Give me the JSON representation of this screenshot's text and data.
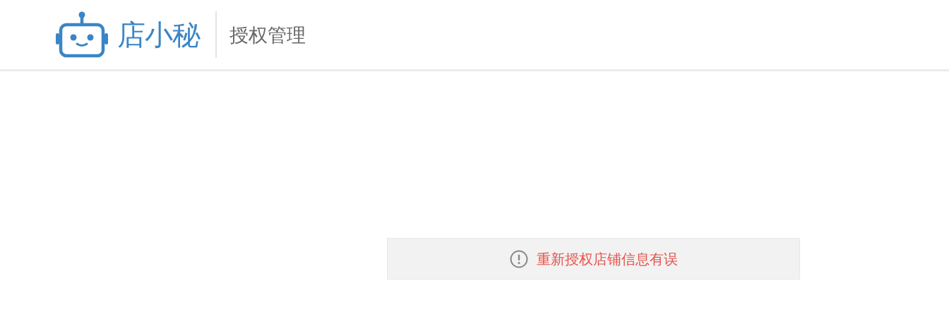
{
  "header": {
    "brand": "店小秘",
    "page_title": "授权管理"
  },
  "notice": {
    "error": true,
    "message": "重新授权店铺信息有误"
  }
}
